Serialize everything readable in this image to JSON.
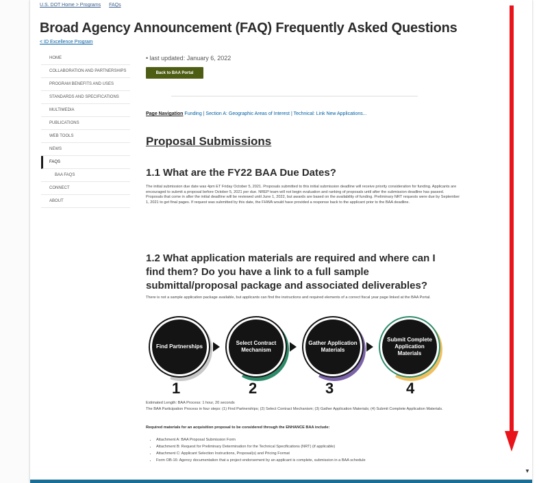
{
  "breadcrumbs": [
    "U.S. DOT Home > Programs",
    "FAQs"
  ],
  "page": {
    "title": "Broad Agency Announcement (FAQ) Frequently Asked Questions",
    "back_link": "< ID Excellence Program",
    "last_updated": "• last updated: January 6, 2022",
    "back_button": "Back to BAA Portal"
  },
  "sidebar": {
    "items": [
      {
        "label": "HOME"
      },
      {
        "label": "COLLABORATION AND PARTNERSHIPS"
      },
      {
        "label": "PROGRAM BENEFITS AND USES"
      },
      {
        "label": "STANDARDS AND SPECIFICATIONS"
      },
      {
        "label": "MULTIMEDIA"
      },
      {
        "label": "PUBLICATIONS"
      },
      {
        "label": "WEB TOOLS"
      },
      {
        "label": "NEWS"
      },
      {
        "label": "FAQS"
      },
      {
        "label": "BAA FAQs"
      },
      {
        "label": "CONNECT"
      },
      {
        "label": "ABOUT"
      }
    ]
  },
  "pagenav": {
    "current": "Page Navigation",
    "links": "Funding | Section A: Geographic Areas of Interest | Technical: Link New Applications..."
  },
  "sections": {
    "proposal_heading": "Proposal Submissions",
    "q11_heading": "1.1  What are the FY22 BAA Due Dates?",
    "q11_body": "The initial submission due date was 4pm ET Friday October 5, 2021. Proposals submitted to this initial submission deadline will receive priority consideration for funding. Applicants are encouraged to submit a proposal before October 5, 2021 per due. NREP team will not begin evaluation and ranking of proposals until after the submission deadline has passed. Proposals that come in after the initial deadline will be reviewed until June 1, 2022, but awards are based on the availability of funding. Preliminary NRT requests were due by September 1, 2021 to get final pages. If request was submitted by this date, the FHWA would have provided a response back to the applicant prior to the BAA deadline.",
    "q12_heading": "1.2  What application materials are required and where can I find them? Do you have a link to a full sample submittal/proposal package and associated deliverables?",
    "q12_body": "There is not a sample application package available, but applicants can find the instructions and required elements of a correct fiscal year page linked at the BAA Portal."
  },
  "process": {
    "steps": [
      {
        "label": "Find Partnerships",
        "number": "1"
      },
      {
        "label": "Select Contract Mechanism",
        "number": "2"
      },
      {
        "label": "Gather Application Materials",
        "number": "3"
      },
      {
        "label": "Submit Complete Application Materials",
        "number": "4"
      }
    ],
    "caption": "Estimated Length: BAA Process: 1 hour, 20 seconds",
    "description": "The BAA Participation Process in four steps: (1) Find Partnerships; (2) Select Contract Mechanism; (3) Gather Application Materials; (4) Submit Complete Application Materials."
  },
  "required": {
    "intro": "Required materials for an acquisition proposal to be considered through the ENHANCE BAA include:",
    "bullets": [
      "Attachment A: BAA Proposal Submission Form",
      "Attachment B: Request for Preliminary Determination for the Technical Specifications (NRT) (if applicable)",
      "Attachment C: Applicant Selection Instructions, Proposal(s) and Pricing Format",
      "Form OB-16: Agency documentation that a project endorsement by an applicant is complete, submission in a BAA schedule"
    ]
  },
  "colors": {
    "button_olive": "#4d5e14",
    "link_blue": "#005ea2",
    "annotation_red": "#e8131b",
    "ring_gray": "#c9c9c9",
    "ring_green": "#2e8b6a",
    "ring_purple": "#7a63a8",
    "ring_gold": "#f0c060"
  },
  "icons": {
    "scroll_down": "triangle-down-icon"
  }
}
